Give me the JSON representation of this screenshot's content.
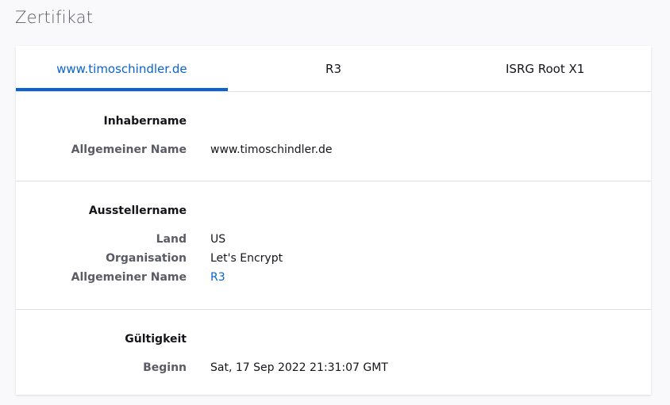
{
  "page": {
    "title": "Zertifikat"
  },
  "tabs": [
    {
      "label": "www.timoschindler.de",
      "active": true
    },
    {
      "label": "R3",
      "active": false
    },
    {
      "label": "ISRG Root X1",
      "active": false
    }
  ],
  "subject": {
    "heading": "Inhabername",
    "common_name_label": "Allgemeiner Name",
    "common_name_value": "www.timoschindler.de"
  },
  "issuer": {
    "heading": "Ausstellername",
    "country_label": "Land",
    "country_value": "US",
    "org_label": "Organisation",
    "org_value": "Let's Encrypt",
    "common_name_label": "Allgemeiner Name",
    "common_name_value": "R3"
  },
  "validity": {
    "heading": "Gültigkeit",
    "begin_label": "Beginn",
    "begin_value": "Sat, 17 Sep 2022 21:31:07 GMT"
  },
  "colors": {
    "accent": "#0a63cf",
    "label": "#5b5b66"
  }
}
